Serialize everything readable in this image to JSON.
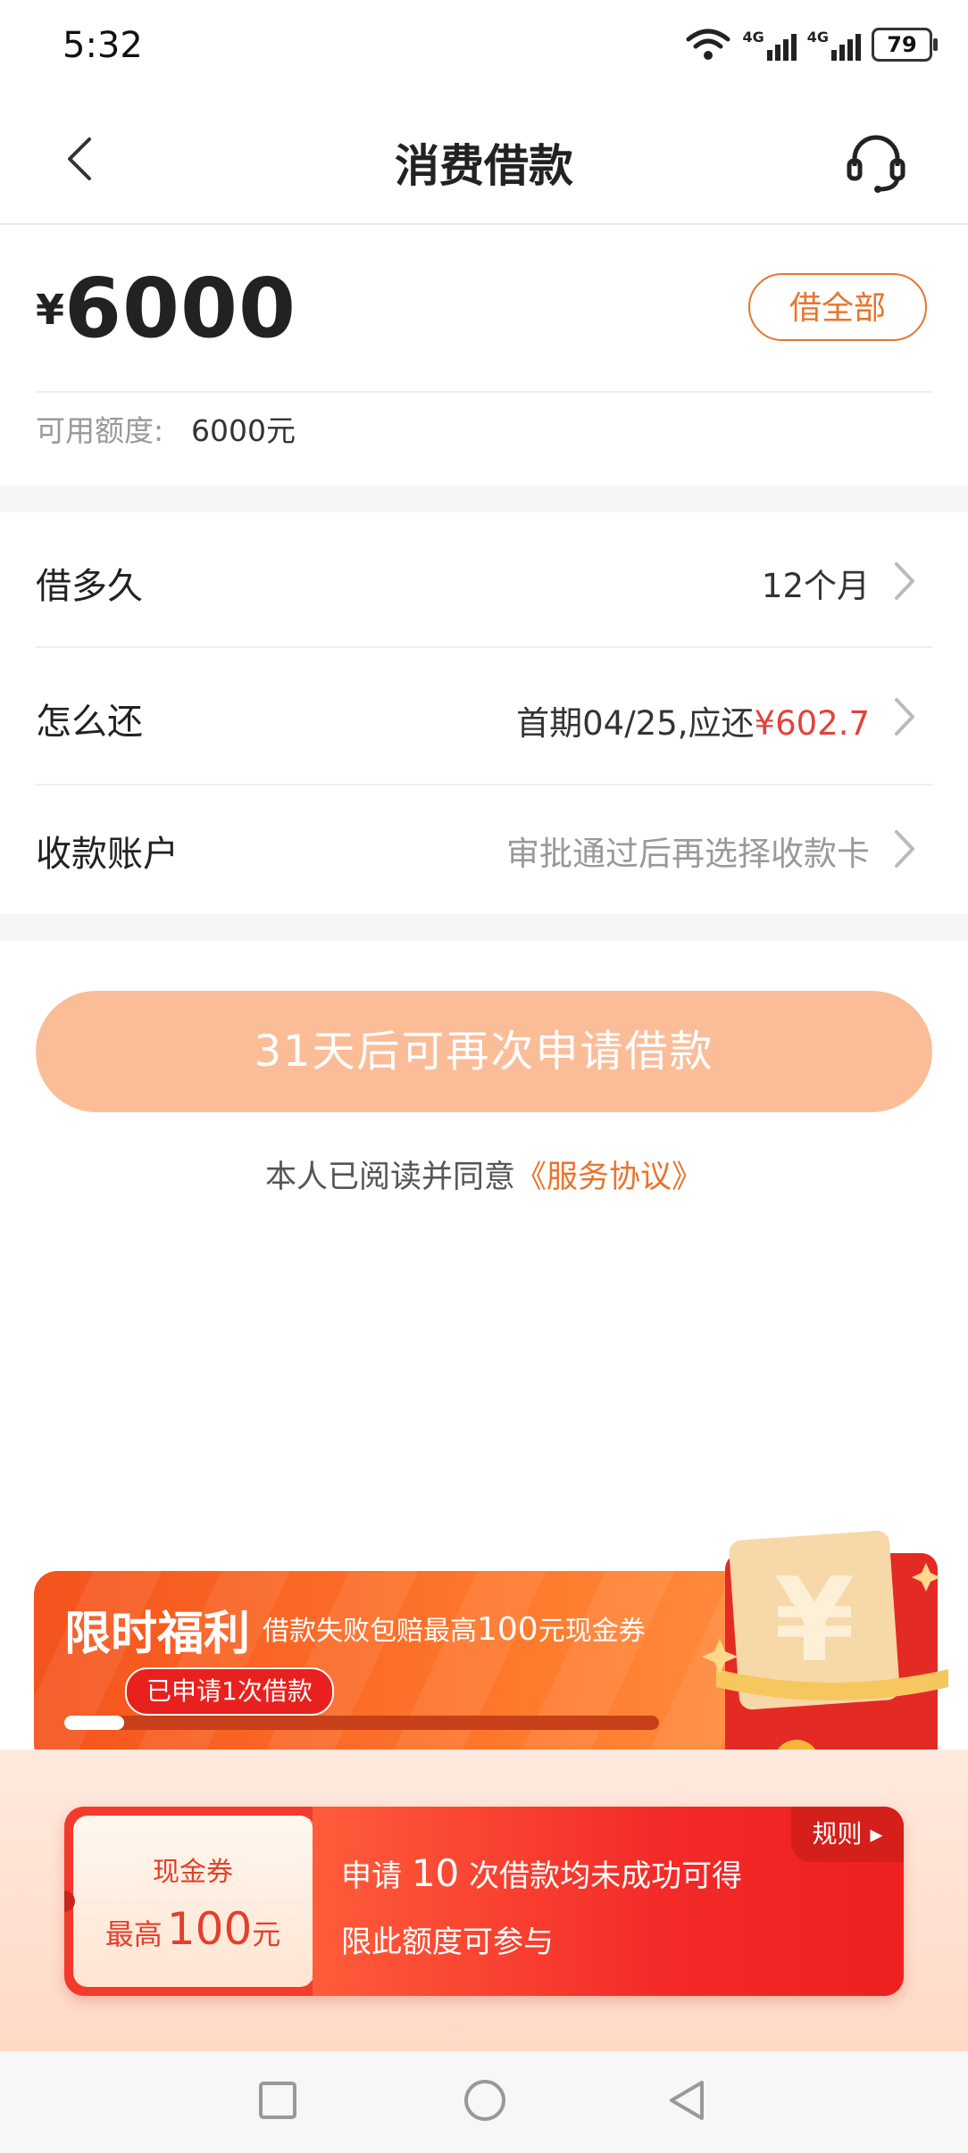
{
  "status_bar": {
    "time": "5:32",
    "battery": "79",
    "network_1": "4G",
    "network_2": "4G"
  },
  "header": {
    "title": "消费借款",
    "back_icon": "chevron-left-icon",
    "support_icon": "headset-icon"
  },
  "amount": {
    "currency": "¥",
    "value": "6000",
    "borrow_all_label": "借全部",
    "available_label": "可用额度:",
    "available_value": "6000元"
  },
  "rows": [
    {
      "label": "借多久",
      "value": "12个月"
    },
    {
      "label": "怎么还",
      "value_prefix": "首期04/25,应还",
      "value_amount": "¥602.7"
    },
    {
      "label": "收款账户",
      "value": "审批通过后再选择收款卡"
    }
  ],
  "apply_button": {
    "label": "31天后可再次申请借款"
  },
  "agreement": {
    "prefix": "本人已阅读并同意",
    "link": "《服务协议》"
  },
  "promo": {
    "title": "限时福利",
    "subtitle_prefix": "借款失败包赔最高",
    "subtitle_amount": "100",
    "subtitle_suffix": "元现金券",
    "progress_badge": "已申请1次借款",
    "progress_fraction": 0.1,
    "coupon": {
      "type": "现金券",
      "amount_prefix": "最高",
      "amount_number": "100",
      "amount_unit": "元",
      "line1_prefix": "申请",
      "line1_number": "10",
      "line1_suffix": "次借款均未成功可得",
      "line2": "限此额度可参与",
      "rules_label": "规则 ▸"
    }
  },
  "colors": {
    "accent": "#e8742d",
    "price_red": "#e5413b",
    "button_disabled": "#fbbd98"
  }
}
